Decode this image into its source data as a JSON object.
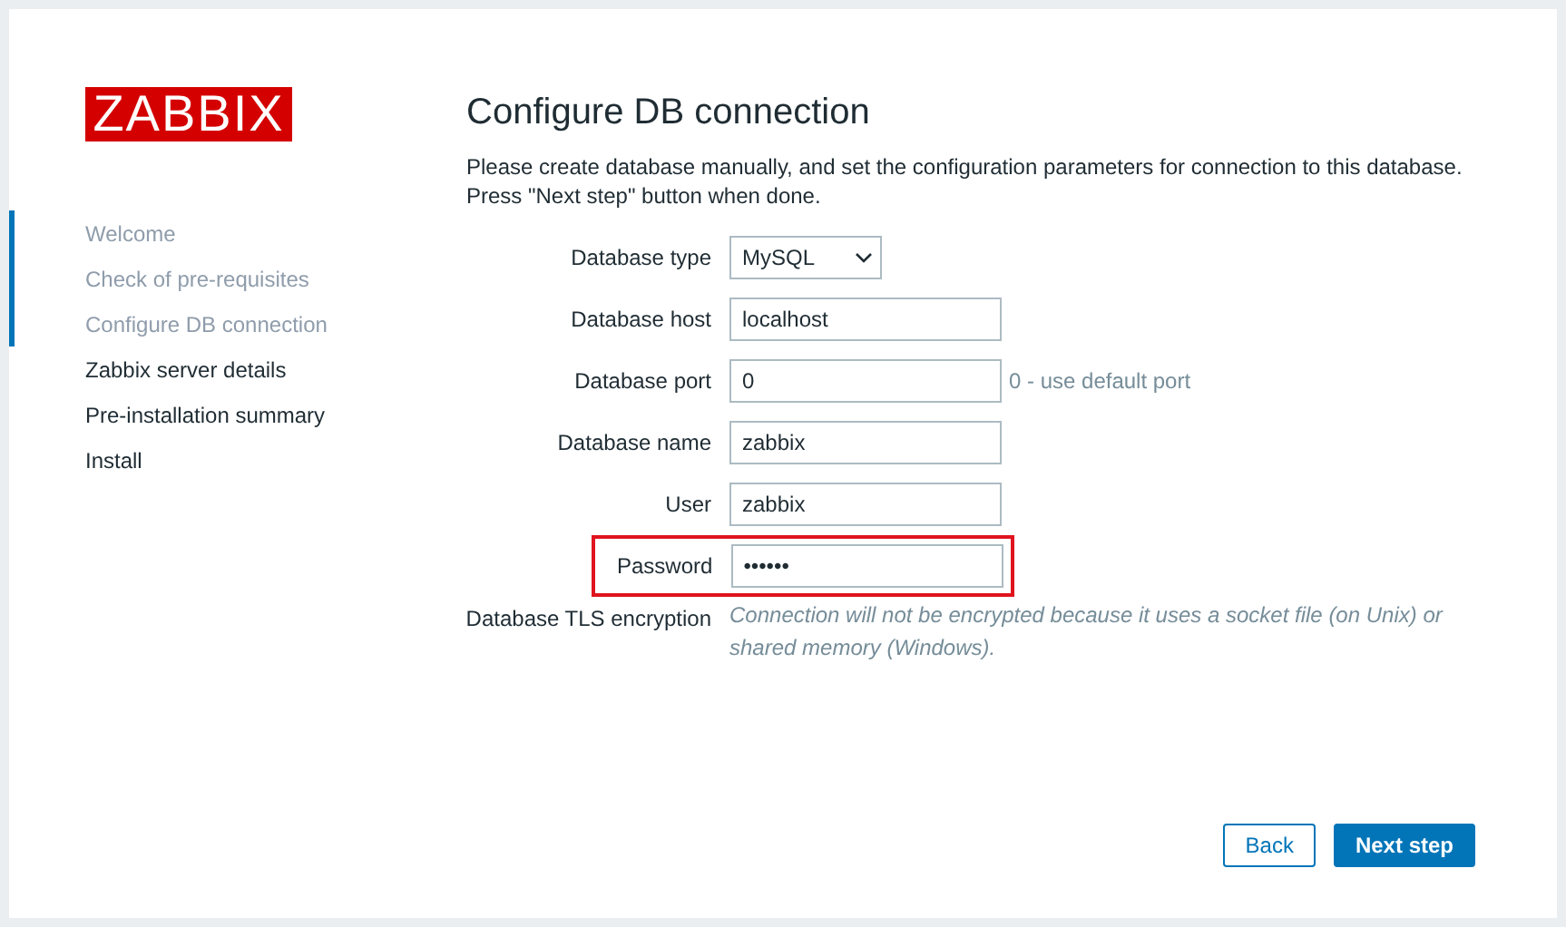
{
  "logo": "ZABBIX",
  "steps": [
    {
      "label": "Welcome",
      "completed": true
    },
    {
      "label": "Check of pre-requisites",
      "completed": true
    },
    {
      "label": "Configure DB connection",
      "completed": true
    },
    {
      "label": "Zabbix server details",
      "completed": false
    },
    {
      "label": "Pre-installation summary",
      "completed": false
    },
    {
      "label": "Install",
      "completed": false
    }
  ],
  "title": "Configure DB connection",
  "intro": [
    "Please create database manually, and set the configuration parameters for connection to this database.",
    "Press \"Next step\" button when done."
  ],
  "fields": [
    {
      "kind": "select",
      "label": "Database type",
      "value": "MySQL",
      "highlighted": false
    },
    {
      "kind": "text",
      "label": "Database host",
      "value": "localhost",
      "highlighted": false
    },
    {
      "kind": "text",
      "label": "Database port",
      "value": "0",
      "hint": "0 - use default port",
      "highlighted": false
    },
    {
      "kind": "text",
      "label": "Database name",
      "value": "zabbix",
      "highlighted": false
    },
    {
      "kind": "text",
      "label": "User",
      "value": "zabbix",
      "highlighted": false
    },
    {
      "kind": "text",
      "label": "Password",
      "value": "••••••",
      "highlighted": true
    },
    {
      "kind": "note",
      "label": "Database TLS encryption",
      "value": "Connection will not be encrypted because it uses a socket file (on Unix) or shared memory (Windows)."
    }
  ],
  "buttons": [
    {
      "kind": "secondary",
      "label": "Back"
    },
    {
      "kind": "primary",
      "label": "Next step"
    }
  ]
}
